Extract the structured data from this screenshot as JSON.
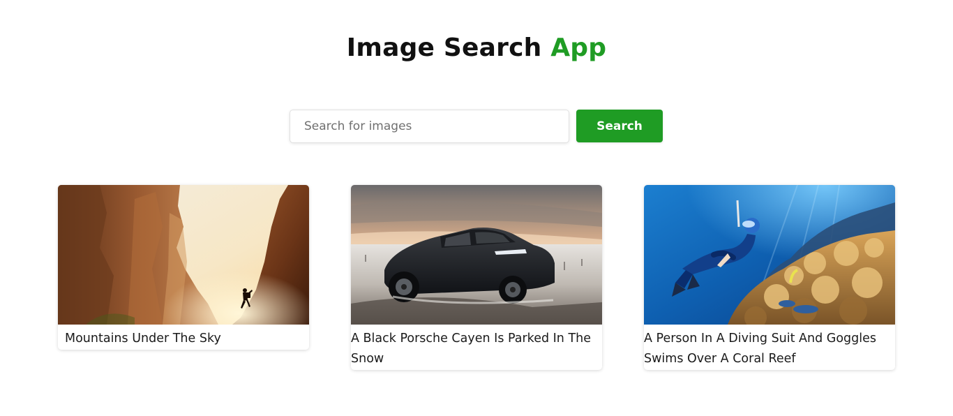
{
  "header": {
    "title_main": "Image Search",
    "title_accent": "App",
    "accent_color": "#1f9c24"
  },
  "search": {
    "placeholder": "Search for images",
    "value": "",
    "button_label": "Search"
  },
  "results": [
    {
      "caption": "Mountains Under The Sky"
    },
    {
      "caption": " A Black Porsche Cayen Is Parked In The Snow"
    },
    {
      "caption": " A Person In A Diving Suit And Goggles Swims Over A Coral Reef"
    }
  ]
}
